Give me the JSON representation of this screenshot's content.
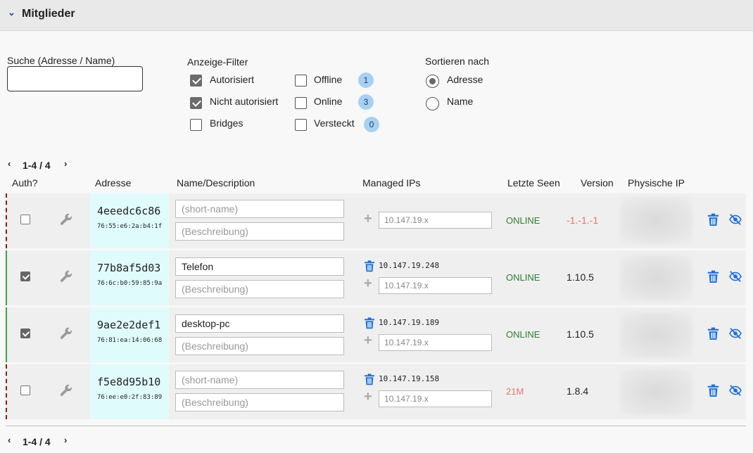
{
  "header": {
    "title": "Mitglieder"
  },
  "search": {
    "label": "Suche (Adresse / Name)",
    "value": ""
  },
  "filter": {
    "label": "Anzeige-Filter",
    "options": [
      {
        "label": "Autorisiert",
        "checked": true
      },
      {
        "label": "Nicht autorisiert",
        "checked": true
      },
      {
        "label": "Bridges",
        "checked": false
      },
      {
        "label": "Offline",
        "checked": false,
        "count": "1"
      },
      {
        "label": "Online",
        "checked": false,
        "count": "3"
      },
      {
        "label": "Versteckt",
        "checked": false,
        "count": "0"
      }
    ]
  },
  "sort": {
    "label": "Sortieren nach",
    "options": [
      {
        "label": "Adresse",
        "selected": true
      },
      {
        "label": "Name",
        "selected": false
      }
    ]
  },
  "pagination": {
    "text": "1-4 / 4"
  },
  "table": {
    "columns": {
      "auth": "Auth?",
      "address": "Adresse",
      "name": "Name/Description",
      "managed_ips": "Managed IPs",
      "last_seen": "Letzte Seen",
      "version": "Version",
      "physical_ip": "Physische IP"
    },
    "placeholders": {
      "short_name": "(short-name)",
      "description": "(Beschreibung)",
      "ip": "10.147.19.x"
    },
    "rows": [
      {
        "auth": false,
        "address": "4eeedc6c86",
        "mac": "76:55:e6:2a:b4:1f",
        "name": "",
        "description": "",
        "ip": "",
        "status": "ONLINE",
        "version": "-1.-1.-1"
      },
      {
        "auth": true,
        "address": "77b8af5d03",
        "mac": "76:6c:b0:59:85:9a",
        "name": "Telefon",
        "description": "",
        "ip": "10.147.19.248",
        "status": "ONLINE",
        "version": "1.10.5"
      },
      {
        "auth": true,
        "address": "9ae2e2def1",
        "mac": "76:81:ea:14:06:68",
        "name": "desktop-pc",
        "description": "",
        "ip": "10.147.19.189",
        "status": "ONLINE",
        "version": "1.10.5"
      },
      {
        "auth": false,
        "address": "f5e8d95b10",
        "mac": "76:ee:e0:2f:83:89",
        "name": "",
        "description": "",
        "ip": "10.147.19.158",
        "status": "21M",
        "version": "1.8.4"
      }
    ]
  },
  "colors": {
    "accent": "#1e6fd9",
    "online": "#2e7d32",
    "offline": "#e57373",
    "version_error": "#e57373",
    "badge": "#a8d0f2",
    "address_bg": "#e0fbfb",
    "authorized_bar": "#3aa54a",
    "unauthorized_bar": "#8b1a1a"
  }
}
